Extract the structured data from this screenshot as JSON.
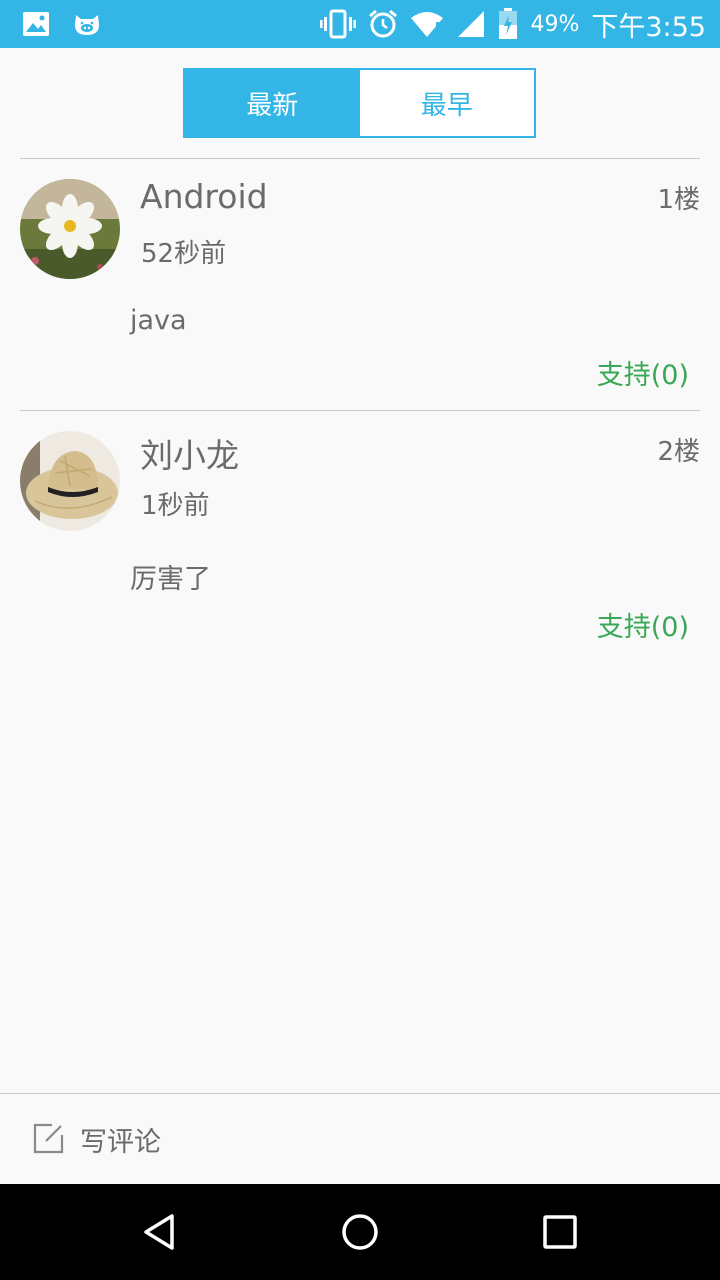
{
  "status_bar": {
    "battery_percent": "49%",
    "time": "下午3:55",
    "icons": [
      "image-icon",
      "cat-icon",
      "vibrate-icon",
      "alarm-icon",
      "wifi-icon",
      "signal-icon",
      "battery-icon"
    ],
    "color": "#33b5e5"
  },
  "tabs": [
    {
      "label": "最新",
      "active": true
    },
    {
      "label": "最早",
      "active": false
    }
  ],
  "comments": [
    {
      "author": "Android",
      "time": "52秒前",
      "floor": "1楼",
      "content": "java",
      "support": "支持(0)",
      "avatar": "flower-avatar"
    },
    {
      "author": "刘小龙",
      "time": "1秒前",
      "floor": "2楼",
      "content": "厉害了",
      "support": "支持(0)",
      "avatar": "hat-avatar"
    }
  ],
  "write_bar": {
    "label": "写评论",
    "icon": "edit-icon"
  },
  "nav_bar": {
    "icons": [
      "back-icon",
      "home-icon",
      "recents-icon"
    ]
  },
  "colors": {
    "accent": "#33b5e5",
    "support": "#3aa757",
    "text": "#6b6b6b"
  }
}
